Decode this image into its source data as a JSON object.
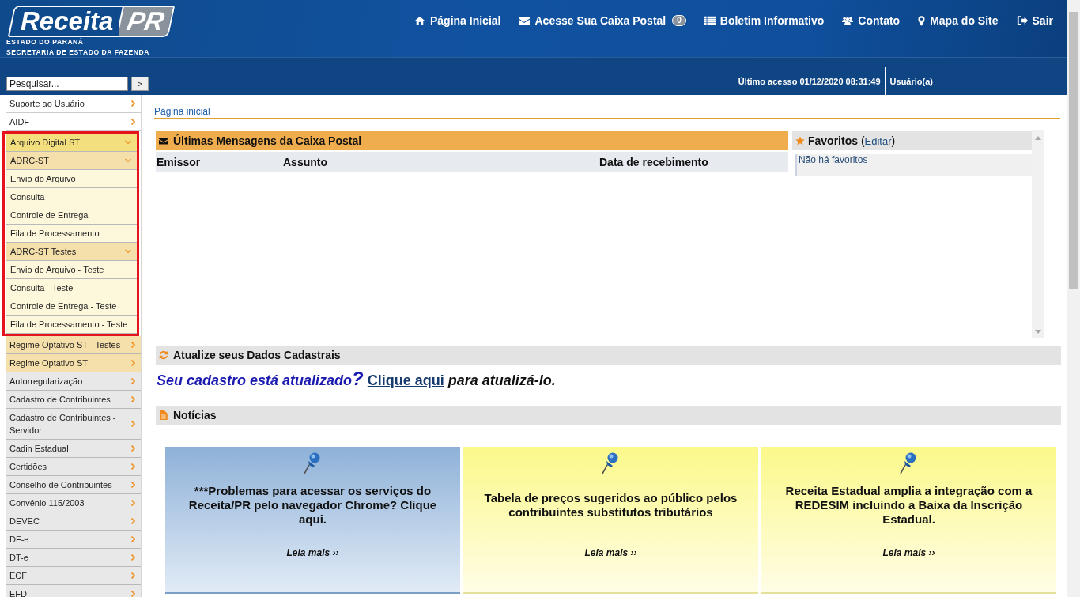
{
  "header": {
    "logo": {
      "left": "Receita",
      "right": "PR"
    },
    "subtitle": [
      "ESTADO DO PARANÁ",
      "SECRETARIA DE ESTADO DA FAZENDA"
    ],
    "nav": [
      {
        "label": "Página Inicial"
      },
      {
        "label": "Acesse Sua Caixa Postal",
        "badge": "0"
      },
      {
        "label": "Boletim Informativo"
      },
      {
        "label": "Contato"
      },
      {
        "label": "Mapa do Site"
      },
      {
        "label": "Sair"
      }
    ],
    "last_access": "Último acesso 01/12/2020 08:31:49",
    "user": "Usuário(a)"
  },
  "sidebar": {
    "search": {
      "placeholder": "Pesquisar...",
      "button": ">"
    },
    "items": [
      {
        "label": "Suporte ao Usuário",
        "kind": "light",
        "expanded": false,
        "highlighted": false
      },
      {
        "label": "AIDF",
        "kind": "light",
        "expanded": false,
        "highlighted": false
      },
      {
        "label": "Arquivo Digital ST",
        "kind": "open",
        "expanded": true,
        "highlighted": true,
        "children": [
          {
            "label": "ADRC-ST",
            "kind": "st",
            "expanded": true,
            "children": [
              {
                "label": "Envio do Arquivo"
              },
              {
                "label": "Consulta"
              },
              {
                "label": "Controle de Entrega"
              },
              {
                "label": "Fila de Processamento"
              }
            ]
          },
          {
            "label": "ADRC-ST Testes",
            "kind": "st",
            "expanded": true,
            "children": [
              {
                "label": "Envio de Arquivo - Teste"
              },
              {
                "label": "Consulta - Teste"
              },
              {
                "label": "Controle de Entrega - Teste"
              },
              {
                "label": "Fila de Processamento - Teste"
              }
            ]
          }
        ]
      },
      {
        "label": "Regime Optativo ST - Testes",
        "kind": "st",
        "expanded": false,
        "highlighted": false
      },
      {
        "label": "Regime Optativo ST",
        "kind": "st",
        "expanded": false,
        "highlighted": false
      },
      {
        "label": "Autorregularização",
        "kind": "default",
        "expanded": false,
        "highlighted": false
      },
      {
        "label": "Cadastro de Contribuintes",
        "kind": "default",
        "expanded": false,
        "highlighted": false
      },
      {
        "label": "Cadastro de Contribuintes - Servidor",
        "kind": "default",
        "expanded": false,
        "highlighted": false
      },
      {
        "label": "Cadin Estadual",
        "kind": "default",
        "expanded": false,
        "highlighted": false
      },
      {
        "label": "Certidões",
        "kind": "default",
        "expanded": false,
        "highlighted": false
      },
      {
        "label": "Conselho de Contribuintes",
        "kind": "default",
        "expanded": false,
        "highlighted": false
      },
      {
        "label": "Convênio 115/2003",
        "kind": "default",
        "expanded": false,
        "highlighted": false
      },
      {
        "label": "DEVEC",
        "kind": "default",
        "expanded": false,
        "highlighted": false
      },
      {
        "label": "DF-e",
        "kind": "default",
        "expanded": false,
        "highlighted": false
      },
      {
        "label": "DT-e",
        "kind": "default",
        "expanded": false,
        "highlighted": false
      },
      {
        "label": "ECF",
        "kind": "default",
        "expanded": false,
        "highlighted": false
      },
      {
        "label": "EFD",
        "kind": "default",
        "expanded": false,
        "highlighted": false
      }
    ]
  },
  "breadcrumb": "Página inicial",
  "mailbox": {
    "title": "Últimas Mensagens da Caixa Postal",
    "columns": [
      "Emissor",
      "Assunto",
      "Data de recebimento"
    ]
  },
  "favorites": {
    "title": "Favoritos",
    "edit_open": "(",
    "edit_link": "Editar",
    "edit_close": ")",
    "empty": "Não há favoritos"
  },
  "update": {
    "title": "Atualize seus Dados Cadastrais",
    "question": "Seu cadastro está atualizado",
    "mark": "?",
    "link": "Clique aqui",
    "after": "para atualizá-lo."
  },
  "news": {
    "title": "Notícias",
    "cards": [
      {
        "title": "***Problemas para acessar os serviços do Receita/PR pelo navegador Chrome? Clique aqui.",
        "more": "Leia mais ››",
        "active": true
      },
      {
        "title": "Tabela de preços sugeridos ao público pelos contribuintes substitutos tributários",
        "more": "Leia mais ››",
        "active": false
      },
      {
        "title": "Receita Estadual amplia a integração com a REDESIM incluindo a Baixa da Inscrição Estadual.",
        "more": "Leia mais ››",
        "active": false
      }
    ]
  }
}
